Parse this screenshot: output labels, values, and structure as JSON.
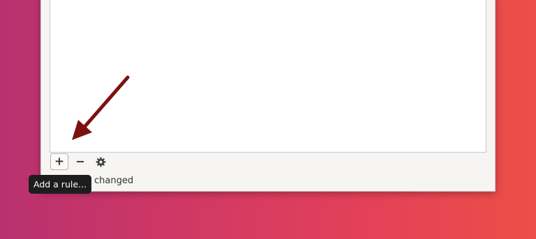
{
  "toolbar": {
    "add_label": "+",
    "add_icon": "plus-icon",
    "remove_icon": "minus-icon",
    "settings_icon": "gear-icon"
  },
  "status": {
    "text": "ng policy changed"
  },
  "tooltip": {
    "text": "Add a rule..."
  },
  "annotation": {
    "arrow_color": "#7d1010"
  },
  "colors": {
    "background_left": "#b8316f",
    "background_right": "#ec4e47"
  }
}
